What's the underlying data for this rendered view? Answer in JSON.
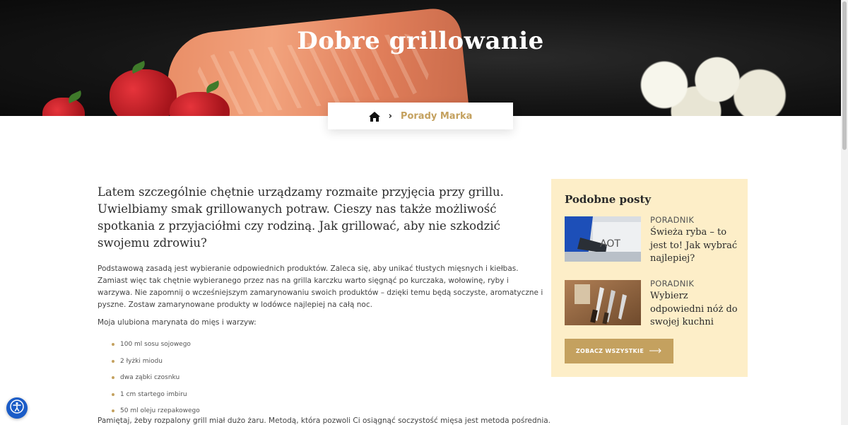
{
  "hero": {
    "title": "Dobre grillowanie"
  },
  "breadcrumb": {
    "home_icon": "home-icon",
    "separator": "›",
    "current": "Porady Marka"
  },
  "article": {
    "lead": "Latem szczególnie chętnie urządzamy rozmaite przyjęcia przy grillu. Uwielbiamy smak grillowanych potraw. Cieszy nas także możliwość spotkania z przyjaciółmi czy rodziną. Jak grillować, aby nie szkodzić swojemu zdrowiu?",
    "paragraph1": "Podstawową zasadą jest wybieranie odpowiednich produktów. Zaleca się, aby unikać tłustych mięsnych i kiełbas. Zamiast więc tak chętnie wybieranego przez nas na grilla karczku warto sięgnąć po kurczaka, wołowinę, ryby i warzywa. Nie zapomnij o wcześniejszym zamarynowaniu swoich produktów – dzięki temu będą soczyste, aromatyczne i pyszne. Zostaw zamarynowane produkty w lodówce najlepiej na całą noc.",
    "paragraph2": "Moja ulubiona marynata do mięs i warzyw:",
    "ingredients": [
      "100 ml sosu sojowego",
      "2 łyżki miodu",
      "dwa ząbki czosnku",
      "1 cm startego imbiru",
      "50 ml oleju rzepakowego"
    ],
    "paragraph3": "Pamiętaj, żeby rozpalony grill miał dużo żaru. Metodą, która pozwoli Ci osiągnąć soczystość mięsa jest metoda pośrednia. Polega ona"
  },
  "sidebar": {
    "title": "Podobne posty",
    "posts": [
      {
        "category": "PORADNIK",
        "title": "Świeża ryba – to jest to! Jak wybrać najlepiej?"
      },
      {
        "category": "PORADNIK",
        "title": "Wybierz odpowiedni nóż do swojej kuchni"
      }
    ],
    "see_all_label": "ZOBACZ WSZYSTKIE",
    "thumb1_text": "AOT"
  },
  "colors": {
    "accent": "#c4a15f",
    "sidebar_bg": "#fdeec8",
    "a11y_blue": "#1b5cc7"
  }
}
